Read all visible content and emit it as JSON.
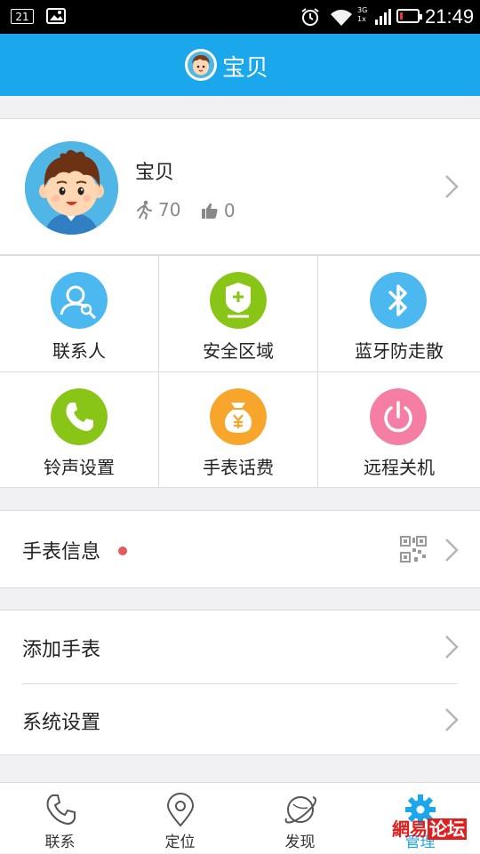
{
  "status_bar": {
    "notification_count": "21",
    "time": "21:49",
    "network": "3G",
    "network_sub": "1x"
  },
  "header": {
    "title": "宝贝"
  },
  "profile": {
    "name": "宝贝",
    "steps": "70",
    "likes": "0"
  },
  "features": [
    {
      "label": "联系人",
      "icon": "contacts-icon",
      "color": "#4cb8f0"
    },
    {
      "label": "安全区域",
      "icon": "safe-zone-icon",
      "color": "#88c516"
    },
    {
      "label": "蓝牙防走散",
      "icon": "bluetooth-icon",
      "color": "#4cb8f0"
    },
    {
      "label": "铃声设置",
      "icon": "phone-icon",
      "color": "#88c516"
    },
    {
      "label": "手表话费",
      "icon": "money-bag-icon",
      "color": "#f7a52b"
    },
    {
      "label": "远程关机",
      "icon": "power-icon",
      "color": "#f57ea4"
    }
  ],
  "watch_info": {
    "label": "手表信息"
  },
  "settings": {
    "add_watch": "添加手表",
    "system_settings": "系统设置"
  },
  "tabs": [
    {
      "label": "联系"
    },
    {
      "label": "定位"
    },
    {
      "label": "发现"
    },
    {
      "label": "管理"
    }
  ],
  "watermark": {
    "text": "網易",
    "boxed": "论坛"
  },
  "colors": {
    "accent": "#1aa7ec",
    "red_dot": "#e35a5a"
  }
}
